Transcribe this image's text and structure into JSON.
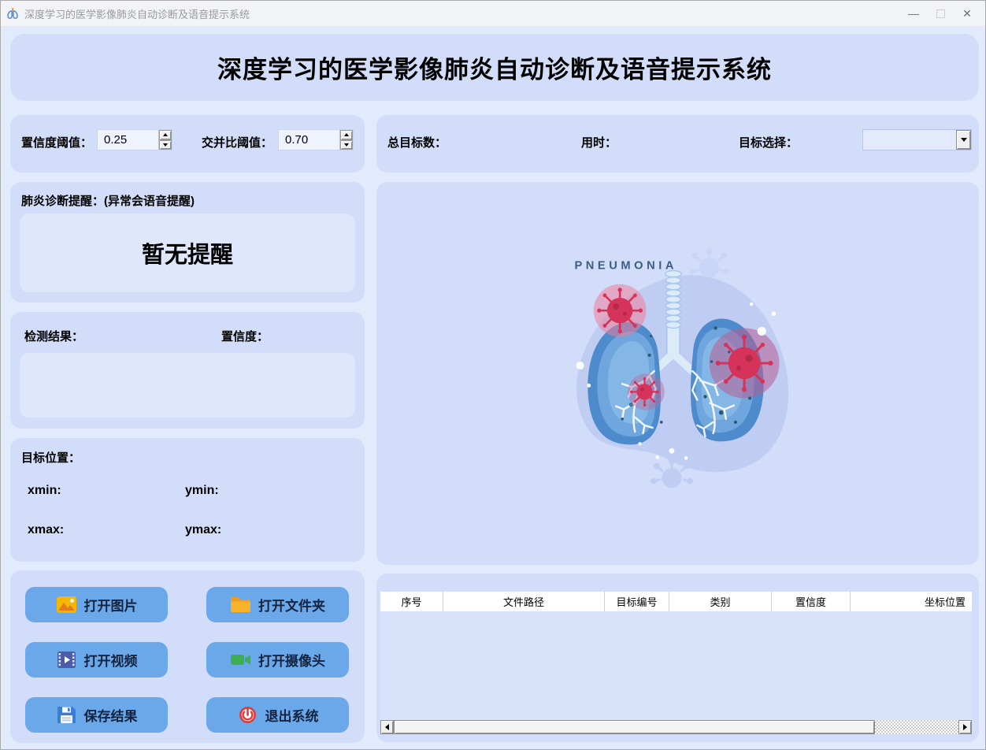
{
  "window": {
    "title": "深度学习的医学影像肺炎自动诊断及语音提示系统",
    "controls": {
      "minimize": "—",
      "close": "✕"
    }
  },
  "header": {
    "title": "深度学习的医学影像肺炎自动诊断及语音提示系统"
  },
  "thresholds": {
    "confidence_label": "置信度阈值：",
    "confidence_value": "0.25",
    "iou_label": "交并比阈值：",
    "iou_value": "0.70"
  },
  "stats": {
    "total_targets_label": "总目标数：",
    "total_targets_value": "",
    "elapsed_label": "用时：",
    "elapsed_value": "",
    "target_select_label": "目标选择：",
    "target_select_value": ""
  },
  "alert": {
    "label": "肺炎诊断提醒：(异常会语音提醒)",
    "message": "暂无提醒"
  },
  "detection": {
    "result_label": "检测结果：",
    "confidence_label": "置信度：",
    "result_value": ""
  },
  "position": {
    "label": "目标位置：",
    "xmin_label": "xmin:",
    "ymin_label": "ymin:",
    "xmax_label": "xmax:",
    "ymax_label": "ymax:",
    "xmin_value": "",
    "ymin_value": "",
    "xmax_value": "",
    "ymax_value": ""
  },
  "buttons": {
    "open_image": "打开图片",
    "open_folder": "打开文件夹",
    "open_video": "打开视频",
    "open_camera": "打开摄像头",
    "save_results": "保存结果",
    "exit_system": "退出系统"
  },
  "illustration": {
    "caption": "PNEUMONIA"
  },
  "table": {
    "columns": [
      "序号",
      "文件路径",
      "目标编号",
      "类别",
      "置信度",
      "坐标位置"
    ],
    "rows": []
  },
  "colors": {
    "panel": "#d2ddfa",
    "inner_box": "#dfe7fc",
    "button_blue": "#6aa8e9",
    "virus_red": "#d6335a",
    "lung_blue": "#4d8bcd",
    "blob": "#c0cdf3"
  }
}
